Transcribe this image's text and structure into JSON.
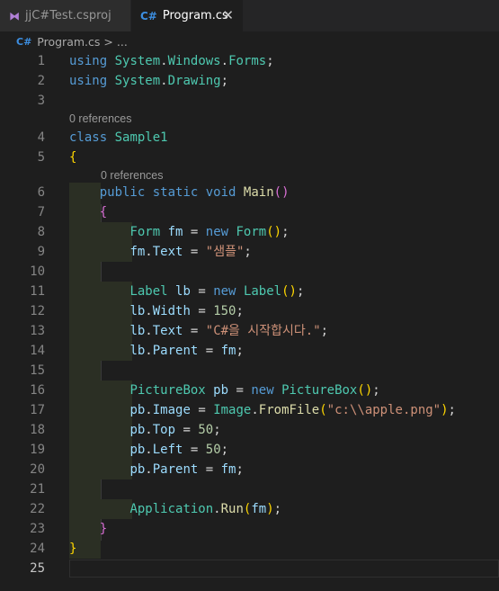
{
  "tabs": [
    {
      "label": "jjC#Test.csproj",
      "icon": "vs-project-icon",
      "active": false
    },
    {
      "label": "Program.cs",
      "icon": "csharp-file-icon",
      "active": true
    }
  ],
  "tab_icon_text": "C#",
  "close_glyph": "✕",
  "breadcrumb": {
    "file": "Program.cs",
    "separator": ">",
    "more": "..."
  },
  "codelens": [
    "0 references",
    "0 references"
  ],
  "line_numbers": [
    "1",
    "2",
    "3",
    "4",
    "5",
    "6",
    "7",
    "8",
    "9",
    "10",
    "11",
    "12",
    "13",
    "14",
    "15",
    "16",
    "17",
    "18",
    "19",
    "20",
    "21",
    "22",
    "23",
    "24",
    "25"
  ],
  "code": {
    "l1": [
      "using",
      "System",
      ".",
      "Windows",
      ".",
      "Forms",
      ";"
    ],
    "l2": [
      "using",
      "System",
      ".",
      "Drawing",
      ";"
    ],
    "l4": [
      "class",
      "Sample1"
    ],
    "l5": [
      "{"
    ],
    "l6": [
      "public",
      "static",
      "void",
      "Main",
      "(",
      ")"
    ],
    "l7": [
      "{"
    ],
    "l8": [
      "Form",
      "fm",
      "=",
      "new",
      "Form",
      "(",
      ")",
      ";"
    ],
    "l9": [
      "fm",
      ".",
      "Text",
      "=",
      "\"샘플\"",
      ";"
    ],
    "l11": [
      "Label",
      "lb",
      "=",
      "new",
      "Label",
      "(",
      ")",
      ";"
    ],
    "l12": [
      "lb",
      ".",
      "Width",
      "=",
      "150",
      ";"
    ],
    "l13": [
      "lb",
      ".",
      "Text",
      "=",
      "\"C#을 시작합시다.\"",
      ";"
    ],
    "l14": [
      "lb",
      ".",
      "Parent",
      "=",
      "fm",
      ";"
    ],
    "l16": [
      "PictureBox",
      "pb",
      "=",
      "new",
      "PictureBox",
      "(",
      ")",
      ";"
    ],
    "l17": [
      "pb",
      ".",
      "Image",
      "=",
      "Image",
      ".",
      "FromFile",
      "(",
      "\"c:\\\\apple.png\"",
      ")",
      ";"
    ],
    "l18": [
      "pb",
      ".",
      "Top",
      "=",
      "50",
      ";"
    ],
    "l19": [
      "pb",
      ".",
      "Left",
      "=",
      "50",
      ";"
    ],
    "l20": [
      "pb",
      ".",
      "Parent",
      "=",
      "fm",
      ";"
    ],
    "l22": [
      "Application",
      ".",
      "Run",
      "(",
      "fm",
      ")",
      ";"
    ],
    "l23": [
      "}"
    ],
    "l24": [
      "}"
    ]
  },
  "colors": {
    "keyword": "#569cd6",
    "type": "#4ec9b0",
    "function": "#dcdcaa",
    "variable": "#9cdcfe",
    "string": "#ce9178",
    "number": "#b5cea8",
    "bracket": "#ffd700"
  }
}
